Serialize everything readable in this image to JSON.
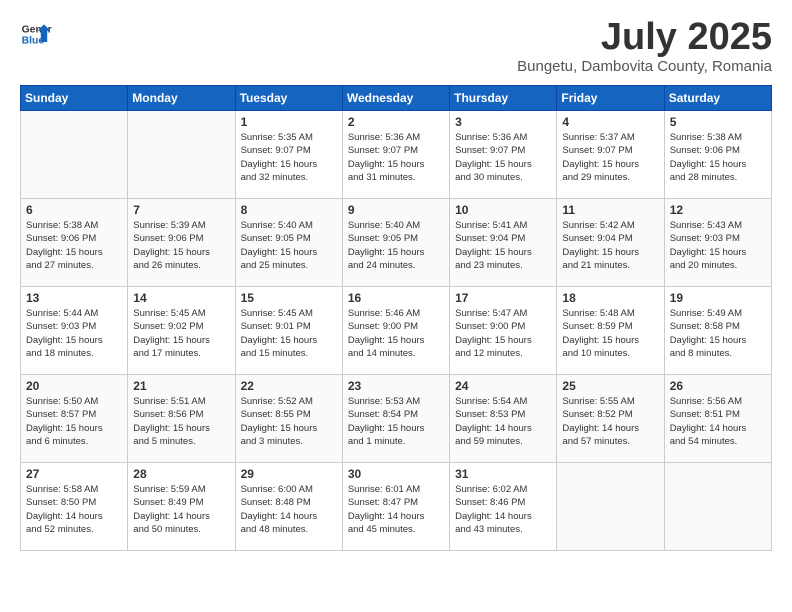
{
  "header": {
    "logo_line1": "General",
    "logo_line2": "Blue",
    "title": "July 2025",
    "subtitle": "Bungetu, Dambovita County, Romania"
  },
  "weekdays": [
    "Sunday",
    "Monday",
    "Tuesday",
    "Wednesday",
    "Thursday",
    "Friday",
    "Saturday"
  ],
  "weeks": [
    [
      {
        "day": "",
        "info": ""
      },
      {
        "day": "",
        "info": ""
      },
      {
        "day": "1",
        "info": "Sunrise: 5:35 AM\nSunset: 9:07 PM\nDaylight: 15 hours\nand 32 minutes."
      },
      {
        "day": "2",
        "info": "Sunrise: 5:36 AM\nSunset: 9:07 PM\nDaylight: 15 hours\nand 31 minutes."
      },
      {
        "day": "3",
        "info": "Sunrise: 5:36 AM\nSunset: 9:07 PM\nDaylight: 15 hours\nand 30 minutes."
      },
      {
        "day": "4",
        "info": "Sunrise: 5:37 AM\nSunset: 9:07 PM\nDaylight: 15 hours\nand 29 minutes."
      },
      {
        "day": "5",
        "info": "Sunrise: 5:38 AM\nSunset: 9:06 PM\nDaylight: 15 hours\nand 28 minutes."
      }
    ],
    [
      {
        "day": "6",
        "info": "Sunrise: 5:38 AM\nSunset: 9:06 PM\nDaylight: 15 hours\nand 27 minutes."
      },
      {
        "day": "7",
        "info": "Sunrise: 5:39 AM\nSunset: 9:06 PM\nDaylight: 15 hours\nand 26 minutes."
      },
      {
        "day": "8",
        "info": "Sunrise: 5:40 AM\nSunset: 9:05 PM\nDaylight: 15 hours\nand 25 minutes."
      },
      {
        "day": "9",
        "info": "Sunrise: 5:40 AM\nSunset: 9:05 PM\nDaylight: 15 hours\nand 24 minutes."
      },
      {
        "day": "10",
        "info": "Sunrise: 5:41 AM\nSunset: 9:04 PM\nDaylight: 15 hours\nand 23 minutes."
      },
      {
        "day": "11",
        "info": "Sunrise: 5:42 AM\nSunset: 9:04 PM\nDaylight: 15 hours\nand 21 minutes."
      },
      {
        "day": "12",
        "info": "Sunrise: 5:43 AM\nSunset: 9:03 PM\nDaylight: 15 hours\nand 20 minutes."
      }
    ],
    [
      {
        "day": "13",
        "info": "Sunrise: 5:44 AM\nSunset: 9:03 PM\nDaylight: 15 hours\nand 18 minutes."
      },
      {
        "day": "14",
        "info": "Sunrise: 5:45 AM\nSunset: 9:02 PM\nDaylight: 15 hours\nand 17 minutes."
      },
      {
        "day": "15",
        "info": "Sunrise: 5:45 AM\nSunset: 9:01 PM\nDaylight: 15 hours\nand 15 minutes."
      },
      {
        "day": "16",
        "info": "Sunrise: 5:46 AM\nSunset: 9:00 PM\nDaylight: 15 hours\nand 14 minutes."
      },
      {
        "day": "17",
        "info": "Sunrise: 5:47 AM\nSunset: 9:00 PM\nDaylight: 15 hours\nand 12 minutes."
      },
      {
        "day": "18",
        "info": "Sunrise: 5:48 AM\nSunset: 8:59 PM\nDaylight: 15 hours\nand 10 minutes."
      },
      {
        "day": "19",
        "info": "Sunrise: 5:49 AM\nSunset: 8:58 PM\nDaylight: 15 hours\nand 8 minutes."
      }
    ],
    [
      {
        "day": "20",
        "info": "Sunrise: 5:50 AM\nSunset: 8:57 PM\nDaylight: 15 hours\nand 6 minutes."
      },
      {
        "day": "21",
        "info": "Sunrise: 5:51 AM\nSunset: 8:56 PM\nDaylight: 15 hours\nand 5 minutes."
      },
      {
        "day": "22",
        "info": "Sunrise: 5:52 AM\nSunset: 8:55 PM\nDaylight: 15 hours\nand 3 minutes."
      },
      {
        "day": "23",
        "info": "Sunrise: 5:53 AM\nSunset: 8:54 PM\nDaylight: 15 hours\nand 1 minute."
      },
      {
        "day": "24",
        "info": "Sunrise: 5:54 AM\nSunset: 8:53 PM\nDaylight: 14 hours\nand 59 minutes."
      },
      {
        "day": "25",
        "info": "Sunrise: 5:55 AM\nSunset: 8:52 PM\nDaylight: 14 hours\nand 57 minutes."
      },
      {
        "day": "26",
        "info": "Sunrise: 5:56 AM\nSunset: 8:51 PM\nDaylight: 14 hours\nand 54 minutes."
      }
    ],
    [
      {
        "day": "27",
        "info": "Sunrise: 5:58 AM\nSunset: 8:50 PM\nDaylight: 14 hours\nand 52 minutes."
      },
      {
        "day": "28",
        "info": "Sunrise: 5:59 AM\nSunset: 8:49 PM\nDaylight: 14 hours\nand 50 minutes."
      },
      {
        "day": "29",
        "info": "Sunrise: 6:00 AM\nSunset: 8:48 PM\nDaylight: 14 hours\nand 48 minutes."
      },
      {
        "day": "30",
        "info": "Sunrise: 6:01 AM\nSunset: 8:47 PM\nDaylight: 14 hours\nand 45 minutes."
      },
      {
        "day": "31",
        "info": "Sunrise: 6:02 AM\nSunset: 8:46 PM\nDaylight: 14 hours\nand 43 minutes."
      },
      {
        "day": "",
        "info": ""
      },
      {
        "day": "",
        "info": ""
      }
    ]
  ]
}
